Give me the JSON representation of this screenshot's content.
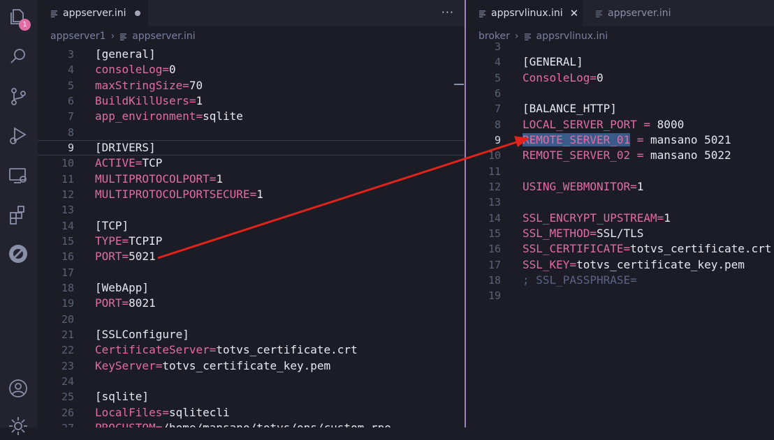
{
  "activity_bar": {
    "explorer_badge": "1",
    "icons": [
      "explorer-icon",
      "search-icon",
      "source-control-icon",
      "run-debug-icon",
      "remote-explorer-icon",
      "extensions-icon",
      "advpl-extension-icon",
      "account-icon",
      "settings-gear-icon"
    ]
  },
  "left_editor": {
    "tab": {
      "label": "appserver.ini",
      "dirty": true
    },
    "more_actions": "···",
    "breadcrumb": {
      "folder": "appserver1",
      "file": "appserver.ini"
    },
    "lines": [
      {
        "n": "3",
        "parts": [
          {
            "t": "sec",
            "v": "[general]"
          }
        ]
      },
      {
        "n": "4",
        "parts": [
          {
            "t": "key",
            "v": "consoleLog"
          },
          {
            "t": "eq",
            "v": "="
          },
          {
            "t": "val",
            "v": "0"
          }
        ]
      },
      {
        "n": "5",
        "parts": [
          {
            "t": "key",
            "v": "maxStringSize"
          },
          {
            "t": "eq",
            "v": "="
          },
          {
            "t": "val",
            "v": "70"
          }
        ]
      },
      {
        "n": "6",
        "parts": [
          {
            "t": "key",
            "v": "BuildKillUsers"
          },
          {
            "t": "eq",
            "v": "="
          },
          {
            "t": "val",
            "v": "1"
          }
        ]
      },
      {
        "n": "7",
        "parts": [
          {
            "t": "key",
            "v": "app_environment"
          },
          {
            "t": "eq",
            "v": "="
          },
          {
            "t": "val",
            "v": "sqlite"
          }
        ]
      },
      {
        "n": "8",
        "parts": []
      },
      {
        "n": "9",
        "current": true,
        "parts": [
          {
            "t": "sec",
            "v": "[DRIVERS]"
          }
        ]
      },
      {
        "n": "10",
        "parts": [
          {
            "t": "key",
            "v": "ACTIVE"
          },
          {
            "t": "eq",
            "v": "="
          },
          {
            "t": "val",
            "v": "TCP"
          }
        ]
      },
      {
        "n": "11",
        "parts": [
          {
            "t": "key",
            "v": "MULTIPROTOCOLPORT"
          },
          {
            "t": "eq",
            "v": "="
          },
          {
            "t": "val",
            "v": "1"
          }
        ]
      },
      {
        "n": "12",
        "parts": [
          {
            "t": "key",
            "v": "MULTIPROTOCOLPORTSECURE"
          },
          {
            "t": "eq",
            "v": "="
          },
          {
            "t": "val",
            "v": "1"
          }
        ]
      },
      {
        "n": "13",
        "parts": []
      },
      {
        "n": "14",
        "parts": [
          {
            "t": "sec",
            "v": "[TCP]"
          }
        ]
      },
      {
        "n": "15",
        "parts": [
          {
            "t": "key",
            "v": "TYPE"
          },
          {
            "t": "eq",
            "v": "="
          },
          {
            "t": "val",
            "v": "TCPIP"
          }
        ]
      },
      {
        "n": "16",
        "parts": [
          {
            "t": "key",
            "v": "PORT"
          },
          {
            "t": "eq",
            "v": "="
          },
          {
            "t": "val",
            "v": "5021"
          }
        ]
      },
      {
        "n": "17",
        "parts": []
      },
      {
        "n": "18",
        "parts": [
          {
            "t": "sec",
            "v": "[WebApp]"
          }
        ]
      },
      {
        "n": "19",
        "parts": [
          {
            "t": "key",
            "v": "PORT"
          },
          {
            "t": "eq",
            "v": "="
          },
          {
            "t": "val",
            "v": "8021"
          }
        ]
      },
      {
        "n": "20",
        "parts": []
      },
      {
        "n": "21",
        "parts": [
          {
            "t": "sec",
            "v": "[SSLConfigure]"
          }
        ]
      },
      {
        "n": "22",
        "parts": [
          {
            "t": "key",
            "v": "CertificateServer"
          },
          {
            "t": "eq",
            "v": "="
          },
          {
            "t": "val",
            "v": "totvs_certificate.crt"
          }
        ]
      },
      {
        "n": "23",
        "parts": [
          {
            "t": "key",
            "v": "KeyServer"
          },
          {
            "t": "eq",
            "v": "="
          },
          {
            "t": "val",
            "v": "totvs_certificate_key.pem"
          }
        ]
      },
      {
        "n": "24",
        "parts": []
      },
      {
        "n": "25",
        "parts": [
          {
            "t": "sec",
            "v": "[sqlite]"
          }
        ]
      },
      {
        "n": "26",
        "parts": [
          {
            "t": "key",
            "v": "LocalFiles"
          },
          {
            "t": "eq",
            "v": "="
          },
          {
            "t": "val",
            "v": "sqlitecli"
          }
        ]
      },
      {
        "n": "27",
        "parts": [
          {
            "t": "key",
            "v": "PROCUSTOM"
          },
          {
            "t": "eq",
            "v": "="
          },
          {
            "t": "val",
            "v": "/home/mansano/totvs/ons/custom.rpo"
          }
        ]
      }
    ]
  },
  "right_editor": {
    "tabs": [
      {
        "label": "appsrvlinux.ini",
        "active": true,
        "close": "✕"
      },
      {
        "label": "appserver.ini",
        "active": false
      }
    ],
    "breadcrumb": {
      "folder": "broker",
      "file": "appsrvlinux.ini"
    },
    "lines": [
      {
        "n": "3",
        "parts": []
      },
      {
        "n": "4",
        "parts": [
          {
            "t": "sec",
            "v": "[GENERAL]"
          }
        ]
      },
      {
        "n": "5",
        "parts": [
          {
            "t": "key",
            "v": "ConsoleLog"
          },
          {
            "t": "eq",
            "v": "="
          },
          {
            "t": "val",
            "v": "0"
          }
        ]
      },
      {
        "n": "6",
        "parts": []
      },
      {
        "n": "7",
        "parts": [
          {
            "t": "sec",
            "v": "[BALANCE_HTTP]"
          }
        ]
      },
      {
        "n": "8",
        "parts": [
          {
            "t": "key",
            "v": "LOCAL_SERVER_PORT"
          },
          {
            "t": "eq",
            "v": " = "
          },
          {
            "t": "val",
            "v": "8000"
          }
        ]
      },
      {
        "n": "9",
        "current": true,
        "parts": [
          {
            "t": "key sel",
            "v": "REMOTE_SERVER_01"
          },
          {
            "t": "eq",
            "v": " = "
          },
          {
            "t": "val",
            "v": "mansano 5021"
          }
        ]
      },
      {
        "n": "10",
        "parts": [
          {
            "t": "key",
            "v": "REMOTE_SERVER_02"
          },
          {
            "t": "eq",
            "v": " = "
          },
          {
            "t": "val",
            "v": "mansano 5022"
          }
        ]
      },
      {
        "n": "11",
        "parts": []
      },
      {
        "n": "12",
        "parts": [
          {
            "t": "key",
            "v": "USING_WEBMONITOR"
          },
          {
            "t": "eq",
            "v": "="
          },
          {
            "t": "val",
            "v": "1"
          }
        ]
      },
      {
        "n": "13",
        "parts": []
      },
      {
        "n": "14",
        "parts": [
          {
            "t": "key",
            "v": "SSL_ENCRYPT_UPSTREAM"
          },
          {
            "t": "eq",
            "v": "="
          },
          {
            "t": "val",
            "v": "1"
          }
        ]
      },
      {
        "n": "15",
        "parts": [
          {
            "t": "key",
            "v": "SSL_METHOD"
          },
          {
            "t": "eq",
            "v": "="
          },
          {
            "t": "val",
            "v": "SSL/TLS"
          }
        ]
      },
      {
        "n": "16",
        "parts": [
          {
            "t": "key",
            "v": "SSL_CERTIFICATE"
          },
          {
            "t": "eq",
            "v": "="
          },
          {
            "t": "val",
            "v": "totvs_certificate.crt"
          }
        ]
      },
      {
        "n": "17",
        "parts": [
          {
            "t": "key",
            "v": "SSL_KEY"
          },
          {
            "t": "eq",
            "v": "="
          },
          {
            "t": "val",
            "v": "totvs_certificate_key.pem"
          }
        ]
      },
      {
        "n": "18",
        "parts": [
          {
            "t": "comment",
            "v": "; SSL_PASSPHRASE="
          }
        ]
      },
      {
        "n": "19",
        "parts": []
      }
    ]
  },
  "colors": {
    "accent_divider": "#9e87c2",
    "key": "#e26ca6",
    "arrow": "#e0231b",
    "badge": "#e36ca5"
  }
}
